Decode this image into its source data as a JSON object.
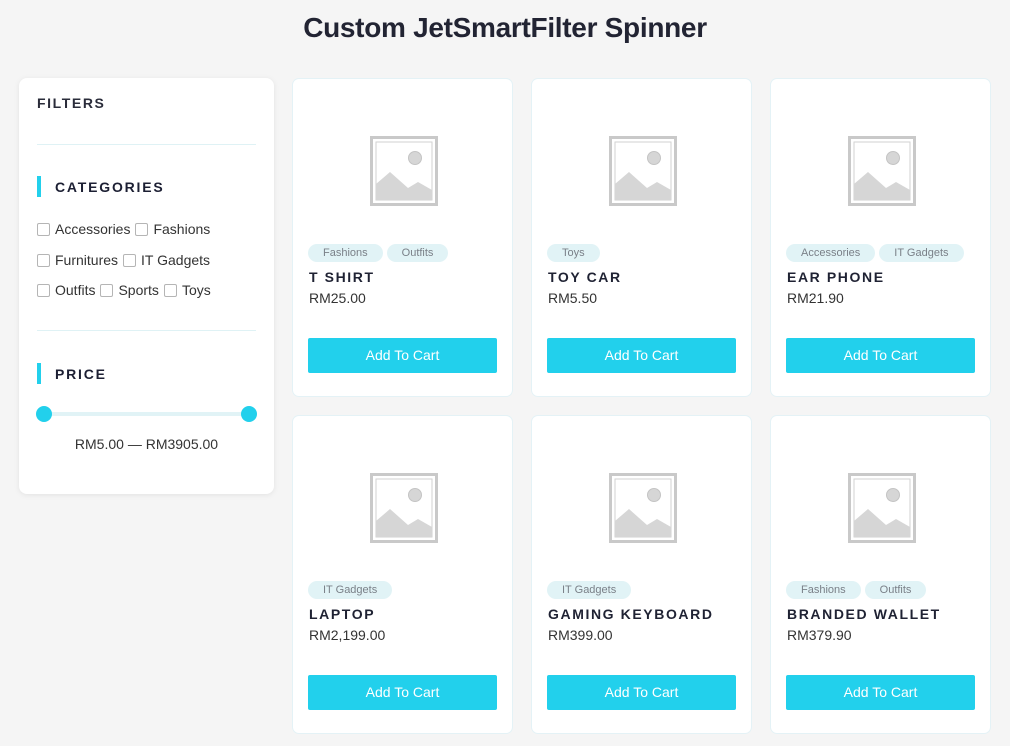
{
  "page": {
    "title": "Custom JetSmartFilter Spinner"
  },
  "filters": {
    "title": "FILTERS",
    "categories": {
      "label": "CATEGORIES",
      "rows": [
        [
          {
            "label": "Accessories",
            "checked": false
          },
          {
            "label": "Fashions",
            "checked": false
          }
        ],
        [
          {
            "label": "Furnitures",
            "checked": false
          },
          {
            "label": "IT Gadgets",
            "checked": false
          }
        ],
        [
          {
            "label": "Outfits",
            "checked": false
          },
          {
            "label": "Sports",
            "checked": false
          },
          {
            "label": "Toys",
            "checked": false
          }
        ]
      ]
    },
    "price": {
      "label": "PRICE",
      "min": 5.0,
      "max": 3905.0,
      "selected_min_fraction": 0,
      "selected_max_fraction": 1,
      "range_text": "RM5.00 — RM3905.00"
    }
  },
  "products": [
    {
      "tags": [
        "Fashions",
        "Outfits"
      ],
      "name": "T SHIRT",
      "price": "RM25.00",
      "button": "Add To Cart",
      "image_icon": "placeholder-image-icon"
    },
    {
      "tags": [
        "Toys"
      ],
      "name": "TOY CAR",
      "price": "RM5.50",
      "button": "Add To Cart",
      "image_icon": "placeholder-image-icon"
    },
    {
      "tags": [
        "Accessories",
        "IT Gadgets"
      ],
      "name": "EAR PHONE",
      "price": "RM21.90",
      "button": "Add To Cart",
      "image_icon": "placeholder-image-icon"
    },
    {
      "tags": [
        "IT Gadgets"
      ],
      "name": "LAPTOP",
      "price": "RM2,199.00",
      "button": "Add To Cart",
      "image_icon": "placeholder-image-icon"
    },
    {
      "tags": [
        "IT Gadgets"
      ],
      "name": "GAMING KEYBOARD",
      "price": "RM399.00",
      "button": "Add To Cart",
      "image_icon": "placeholder-image-icon"
    },
    {
      "tags": [
        "Fashions",
        "Outfits"
      ],
      "name": "BRANDED WALLET",
      "price": "RM379.90",
      "button": "Add To Cart",
      "image_icon": "placeholder-image-icon"
    }
  ],
  "colors": {
    "accent": "#22d0ec",
    "tag_bg": "#e1f3f6",
    "page_bg": "#f5f5f5"
  }
}
